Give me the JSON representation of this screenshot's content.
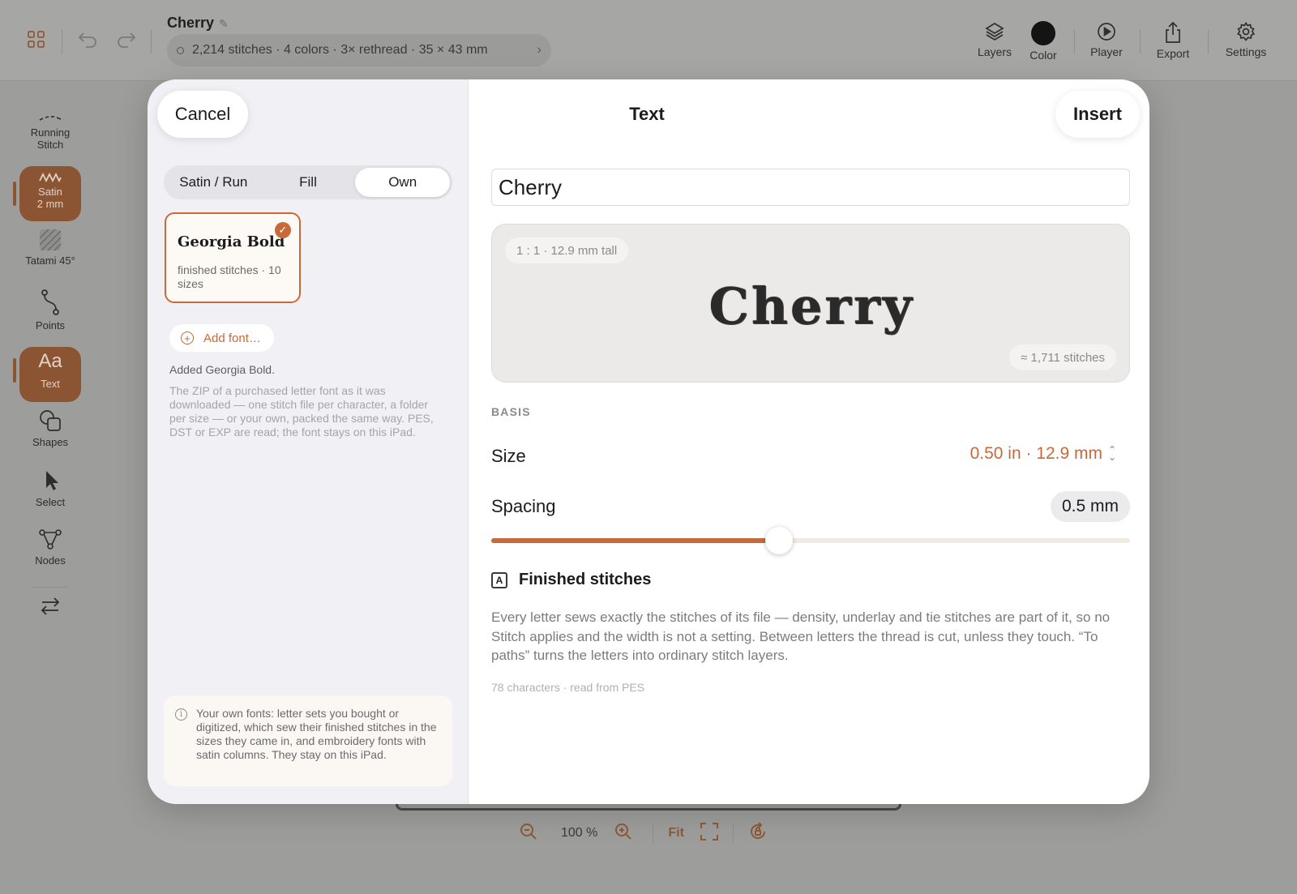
{
  "topbar": {
    "doc_title": "Cherry",
    "doc_stats": "2,214 stitches · 4 colors · 3× rethread · 35 × 43 mm",
    "tools": [
      {
        "label": "Layers",
        "icon": "layers-icon"
      },
      {
        "label": "Color",
        "icon": "color-swatch",
        "color": "#141414"
      },
      {
        "label": "Player",
        "icon": "play-icon"
      },
      {
        "label": "Export",
        "icon": "share-icon"
      },
      {
        "label": "Settings",
        "icon": "gear-icon"
      }
    ]
  },
  "rail": {
    "items": [
      {
        "label": "Running Stitch",
        "icon": "running-stitch-icon"
      },
      {
        "label": "Satin",
        "sublabel": "2 mm",
        "icon": "satin-icon",
        "active": true
      },
      {
        "label": "Tatami 45°",
        "icon": "tatami-icon"
      },
      {
        "label": "Points",
        "icon": "points-icon"
      },
      {
        "label": "Text",
        "icon": "text-icon",
        "glyph": "Aa",
        "active": true
      },
      {
        "label": "Shapes",
        "icon": "shapes-icon"
      },
      {
        "label": "Select",
        "icon": "cursor-icon"
      },
      {
        "label": "Nodes",
        "icon": "nodes-icon"
      }
    ]
  },
  "zoom": {
    "level": "100 %",
    "fit_label": "Fit"
  },
  "modal": {
    "title": "Text",
    "cancel_label": "Cancel",
    "insert_label": "Insert",
    "tabs": [
      {
        "label": "Satin / Run",
        "selected": false
      },
      {
        "label": "Fill",
        "selected": false
      },
      {
        "label": "Own",
        "selected": true
      }
    ],
    "font_card": {
      "name": "Georgia Bold",
      "subtitle": "finished stitches · 10 sizes",
      "selected": true,
      "check": "✓"
    },
    "add_font_label": "Add font…",
    "added_message": "Added Georgia Bold.",
    "zip_note": "The ZIP of a purchased letter font as it was downloaded — one stitch file per character, a folder per size — or your own, packed the same way. PES, DST or EXP are read; the font stays on this iPad.",
    "info_note": "Your own fonts: letter sets you bought or digitized, which sew their finished stitches in the sizes they came in, and embroidery fonts with satin columns. They stay on this iPad.",
    "text_value": "Cherry",
    "preview": {
      "scale": "1 : 1 · 12.9 mm tall",
      "stitches": "≈ 1,711 stitches",
      "text": "Cherry"
    },
    "basis_header": "BASIS",
    "size": {
      "label": "Size",
      "value": "0.50 in · 12.9 mm"
    },
    "spacing": {
      "label": "Spacing",
      "value": "0.5 mm",
      "slider_fraction": 0.45
    },
    "finished": {
      "title": "Finished stitches",
      "glyph": "A",
      "description": "Every letter sews exactly the stitches of its file — density, underlay and tie stitches are part of it, so no Stitch applies and the width is not a setting. Between letters the thread is cut, unless they touch. “To paths” turns the letters into ordinary stitch layers.",
      "footer": "78 characters · read from PES"
    },
    "accent": "#c8693a"
  }
}
